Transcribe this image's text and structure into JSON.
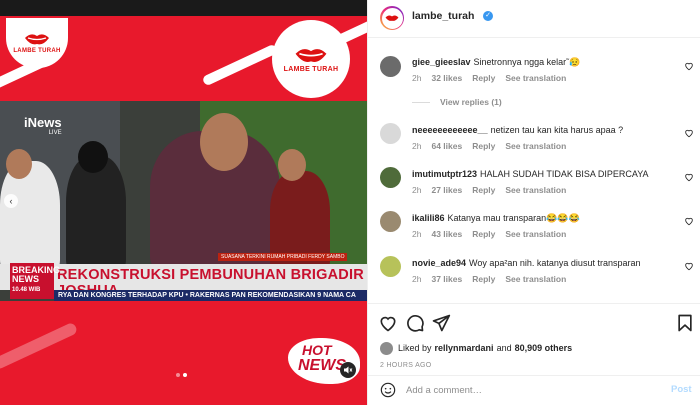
{
  "post": {
    "handle": "lambe_turah",
    "verified": true,
    "logo_text": "LAMBE TURAH"
  },
  "media": {
    "channel": "iNews",
    "channel_sub": "LIVE",
    "caption_small": "SUASANA TERKINI RUMAH PRIBADI FERDY SAMBO",
    "breaking_line1": "BREAKING",
    "breaking_line2": "NEWS",
    "breaking_time": "10.48 WIB",
    "headline": "REKONSTRUKSI PEMBUNUHAN BRIGADIR JOSHUA",
    "ticker": "RYA DAN KONGRES TERHADAP KPU  •  RAKERNAS PAN REKOMENDASIKAN 9 NAMA CA",
    "hot_news_1": "HOT",
    "hot_news_2": "NEWS",
    "accent": "#e8192c"
  },
  "comments": [
    {
      "user": "giee_gieeslav",
      "text": "Sinetronnya ngga kelar˜😥",
      "time": "2h",
      "likes": "32 likes",
      "reply": "Reply",
      "translate": "See translation",
      "view_replies": "View replies (1)",
      "avatar_color": "#6b6b6b"
    },
    {
      "user": "neeeeeeeeeeee__",
      "text": "netizen tau kan kita harus apaa ?",
      "time": "2h",
      "likes": "64 likes",
      "reply": "Reply",
      "translate": "See translation",
      "avatar_color": "#d9d9d9"
    },
    {
      "user": "imutimutptr123",
      "text": "HALAH SUDAH TIDAK BISA DIPERCAYA",
      "time": "2h",
      "likes": "27 likes",
      "reply": "Reply",
      "translate": "See translation",
      "avatar_color": "#4f6b3a"
    },
    {
      "user": "ikalili86",
      "text": "Katanya mau transparan😂😂😂",
      "time": "2h",
      "likes": "43 likes",
      "reply": "Reply",
      "translate": "See translation",
      "avatar_color": "#9a8a70"
    },
    {
      "user": "novie_ade94",
      "text": "Woy apa²an nih. katanya diusut transparan",
      "time": "2h",
      "likes": "37 likes",
      "reply": "Reply",
      "translate": "See translation",
      "avatar_color": "#b7c25a"
    }
  ],
  "likes_line": {
    "prefix": "Liked by",
    "user": "rellynmardani",
    "and": "and",
    "count": "80,909 others"
  },
  "time_ago": "2 HOURS AGO",
  "add_comment": {
    "placeholder": "Add a comment…",
    "post_label": "Post"
  }
}
